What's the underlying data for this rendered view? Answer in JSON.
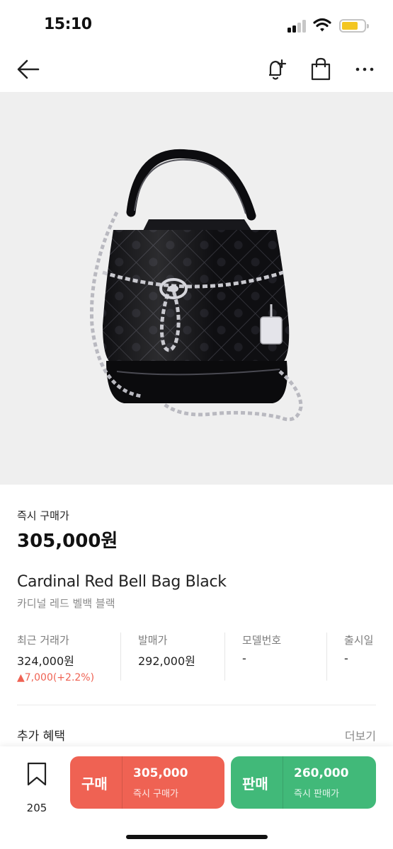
{
  "status_bar": {
    "time": "15:10"
  },
  "product": {
    "immediate_price_label": "즉시 구매가",
    "immediate_price": "305,000원",
    "name": "Cardinal Red Bell Bag Black",
    "name_ko": "카디널 레드 벨백 블랙"
  },
  "stats": [
    {
      "label": "최근 거래가",
      "value": "324,000원",
      "change": "▲7,000(+2.2%)"
    },
    {
      "label": "발매가",
      "value": "292,000원"
    },
    {
      "label": "모델번호",
      "value": "-"
    },
    {
      "label": "출시일",
      "value": "-"
    }
  ],
  "benefits": {
    "title": "추가 혜택",
    "more": "더보기"
  },
  "bottom_bar": {
    "wish_count": "205",
    "buy": {
      "label": "구매",
      "amount": "305,000",
      "sub": "즉시 구매가",
      "color": "#ef6253"
    },
    "sell": {
      "label": "판매",
      "amount": "260,000",
      "sub": "즉시 판매가",
      "color": "#41b979"
    }
  },
  "icons": [
    "back-arrow-icon",
    "bell-plus-icon",
    "shopping-bag-icon",
    "more-icon",
    "bookmark-icon"
  ]
}
